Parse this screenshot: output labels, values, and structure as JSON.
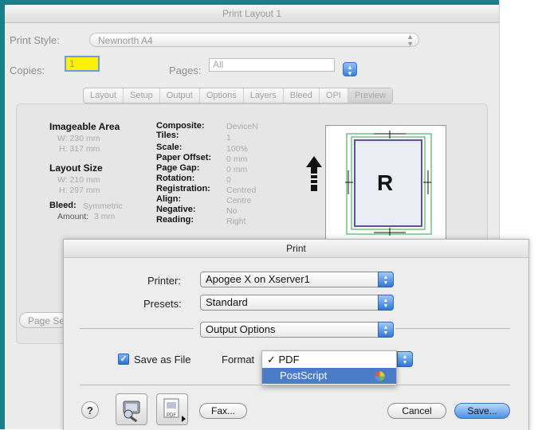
{
  "layout_window": {
    "title": "Print Layout 1",
    "print_style_label": "Print Style:",
    "print_style_value": "Newnorth A4",
    "copies_label": "Copies:",
    "copies_value": "1",
    "pages_label": "Pages:",
    "pages_value": "All",
    "tabs": [
      "Layout",
      "Setup",
      "Output",
      "Options",
      "Layers",
      "Bleed",
      "OPI",
      "Preview"
    ],
    "active_tab": "Preview",
    "imageable_area_heading": "Imageable Area",
    "imageable_w": "W: 230 mm",
    "imageable_h": "H: 317 mm",
    "layout_size_heading": "Layout Size",
    "layout_w": "W: 210 mm",
    "layout_h": "H: 297 mm",
    "bleed_label": "Bleed:",
    "bleed_value": "Symmetric",
    "amount_label": "Amount:",
    "amount_value": "3 mm",
    "settings": [
      {
        "label": "Composite:",
        "value": "DeviceN"
      },
      {
        "label": "Tiles:",
        "value": "1"
      },
      {
        "label": "Scale:",
        "value": "100%"
      },
      {
        "label": "Paper Offset:",
        "value": "0 mm"
      },
      {
        "label": "Page Gap:",
        "value": "0 mm"
      },
      {
        "label": "Rotation:",
        "value": "0"
      },
      {
        "label": "Registration:",
        "value": "Centred"
      },
      {
        "label": "Align:",
        "value": "Centre"
      },
      {
        "label": "Negative:",
        "value": "No"
      },
      {
        "label": "Reading:",
        "value": "Right"
      }
    ],
    "preview_letter": "R",
    "page_setup_label": "Page Se"
  },
  "print_sheet": {
    "title": "Print",
    "printer_label": "Printer:",
    "printer_value": "Apogee X on Xserver1",
    "presets_label": "Presets:",
    "presets_value": "Standard",
    "panel_value": "Output Options",
    "save_as_file_label": "Save as File",
    "save_as_file_checked": true,
    "format_label": "Format",
    "format_menu": [
      {
        "label": "PDF",
        "checked": true
      },
      {
        "label": "PostScript",
        "highlighted": true
      }
    ],
    "help_label": "?",
    "pdf_icon_label": "PDF",
    "fax_label": "Fax...",
    "cancel_label": "Cancel",
    "save_label": "Save..."
  },
  "colors": {
    "frame": "#1a7f8a",
    "menu_highlight": "#4a7cc7",
    "copies_highlight": "#ffef00"
  }
}
